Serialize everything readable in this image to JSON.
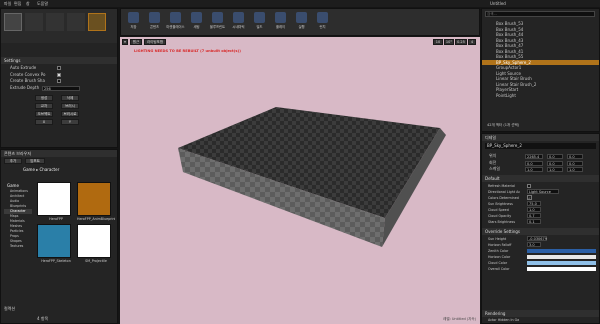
{
  "menu": [
    "파일",
    "편집",
    "창",
    "도움말"
  ],
  "window_title": "Untitled",
  "toolbar": [
    "저장",
    "콘텐츠",
    "마켓플레이스",
    "세팅",
    "블루프린트",
    "시네마틱",
    "빌드",
    "플레이",
    "실행",
    "런치"
  ],
  "viewport": {
    "view_mode": "원근",
    "lit": "라이팅포함",
    "warning": "LIGHTING NEEDS TO BE REBUILT (7 unbuilt object(s))",
    "snap": [
      "10",
      "10°",
      "0.25"
    ],
    "camera_speed": "4",
    "level_label": "레벨: Untitled (지속)"
  },
  "geometry": {
    "title": "Settings",
    "fields": [
      {
        "label": "Auto Extrude",
        "checked": false
      },
      {
        "label": "Create Convex Po",
        "checked": true
      },
      {
        "label": "Create Brush Sha",
        "checked": false
      }
    ],
    "extrude_label": "Extrude Depth",
    "extrude_value": "256",
    "buttons": [
      [
        "생성",
        "삭제"
      ],
      [
        "교차",
        "브러시"
      ],
      [
        "오브젝트",
        "브러시로"
      ],
      [
        "X",
        "Y"
      ]
    ]
  },
  "content_browser": {
    "tab": "콘텐츠 브라우저",
    "add": "추가",
    "import": "임포트",
    "path": [
      "Game",
      "Character"
    ],
    "tree": [
      "Game",
      "Animations",
      "Architect",
      "Audio",
      "Blueprints",
      "Character",
      "Maps",
      "Materials",
      "Meshes",
      "Particles",
      "Props",
      "Shapes",
      "Textures"
    ],
    "assets": [
      {
        "name": "HeroFPP",
        "color": "#ffffff"
      },
      {
        "name": "HeroFPP_AnimBlueprint",
        "color": "#b06a10"
      },
      {
        "name": "HeroFPP_Skeleton",
        "color": "#2a7fa8"
      },
      {
        "name": "SM_Projectile",
        "color": "#ffffff"
      }
    ],
    "count": "4 항목",
    "collections": "컬렉션"
  },
  "outliner": {
    "search_placeholder": "검색...",
    "items": [
      "Box Brush_53",
      "Box Brush_54",
      "Box Brush_44",
      "Box Brush_43",
      "Box Brush_47",
      "Box Brush_41",
      "Box Brush_55",
      "BP_Sky_Sphere_2",
      "GroupActor1",
      "Light Source",
      "Linear Stair Brush",
      "Linear Stair Brush_2",
      "PlayerStart",
      "PointLight"
    ],
    "selected_index": 7,
    "count": "42개 액터 (1개 선택)"
  },
  "details": {
    "tab": "디테일",
    "object": "BP_Sky_Sphere_2",
    "transform": [
      {
        "label": "위치",
        "values": [
          "2265.4",
          "0.0",
          "0.0"
        ]
      },
      {
        "label": "회전",
        "values": [
          "0.0",
          "0.0",
          "0.0"
        ]
      },
      {
        "label": "스케일",
        "values": [
          "1.0",
          "1.0",
          "1.0"
        ]
      }
    ],
    "default_title": "Default",
    "default_rows": [
      {
        "label": "Refresh Material",
        "value": ""
      },
      {
        "label": "Directional Light Ac",
        "value": "Light Source"
      },
      {
        "label": "Colors Determined",
        "value": "✓"
      },
      {
        "label": "Sun Brightness",
        "value": "75.0"
      },
      {
        "label": "Cloud Speed",
        "value": "1.0"
      },
      {
        "label": "Cloud Opacity",
        "value": "0.7"
      },
      {
        "label": "Stars Brightness",
        "value": "0.1"
      }
    ],
    "override_title": "Override Settings",
    "override_rows": [
      {
        "label": "Sun Height",
        "value": "-0.030679"
      },
      {
        "label": "Horizon Falloff",
        "value": "3.0"
      },
      {
        "label": "Zenith Color",
        "value": "#2b5fa5"
      },
      {
        "label": "Horizon Color",
        "value": "#e8e8e8"
      },
      {
        "label": "Cloud Color",
        "value": "#8fc0e8"
      },
      {
        "label": "Overall Color",
        "value": "#ffffff"
      }
    ],
    "rendering_title": "Rendering",
    "rendering_row": "Actor Hidden In Ga"
  }
}
